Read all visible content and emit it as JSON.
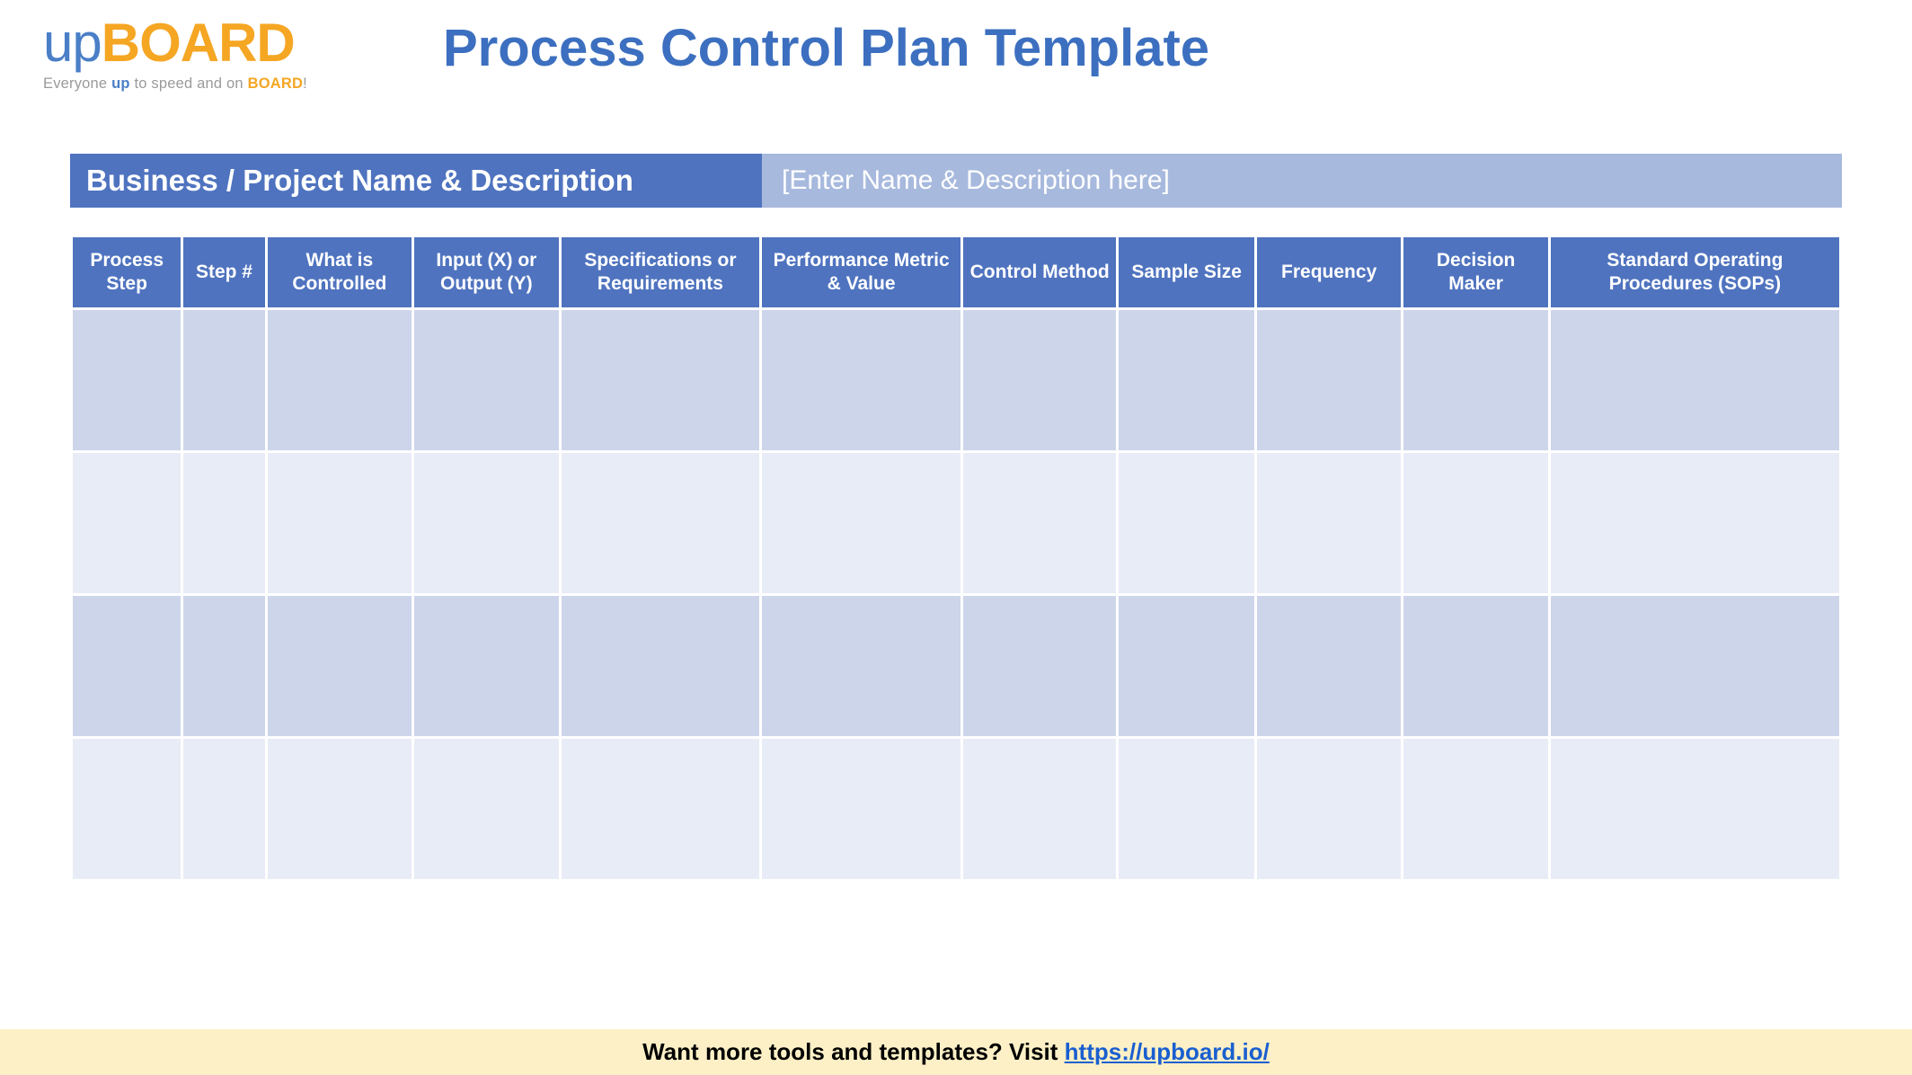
{
  "logo": {
    "up": "up",
    "board": "BOARD",
    "tagline_pre": "Everyone ",
    "tagline_up": "up",
    "tagline_mid": " to speed and on ",
    "tagline_board": "BOARD",
    "tagline_post": "!"
  },
  "title": "Process Control Plan Template",
  "banner": {
    "label": "Business / Project Name & Description",
    "placeholder": "[Enter Name & Description here]"
  },
  "table": {
    "headers": [
      "Process Step",
      "Step #",
      "What is Controlled",
      "Input (X) or Output (Y)",
      "Specifications or Requirements",
      "Performance Metric & Value",
      "Control Method",
      "Sample Size",
      "Frequency",
      "Decision Maker",
      "Standard Operating Procedures (SOPs)"
    ],
    "rows": [
      [
        "",
        "",
        "",
        "",
        "",
        "",
        "",
        "",
        "",
        "",
        ""
      ],
      [
        "",
        "",
        "",
        "",
        "",
        "",
        "",
        "",
        "",
        "",
        ""
      ],
      [
        "",
        "",
        "",
        "",
        "",
        "",
        "",
        "",
        "",
        "",
        ""
      ],
      [
        "",
        "",
        "",
        "",
        "",
        "",
        "",
        "",
        "",
        "",
        ""
      ]
    ]
  },
  "footer": {
    "text": "Want more tools and templates? Visit ",
    "link_text": "https://upboard.io/",
    "link_href": "https://upboard.io/"
  }
}
